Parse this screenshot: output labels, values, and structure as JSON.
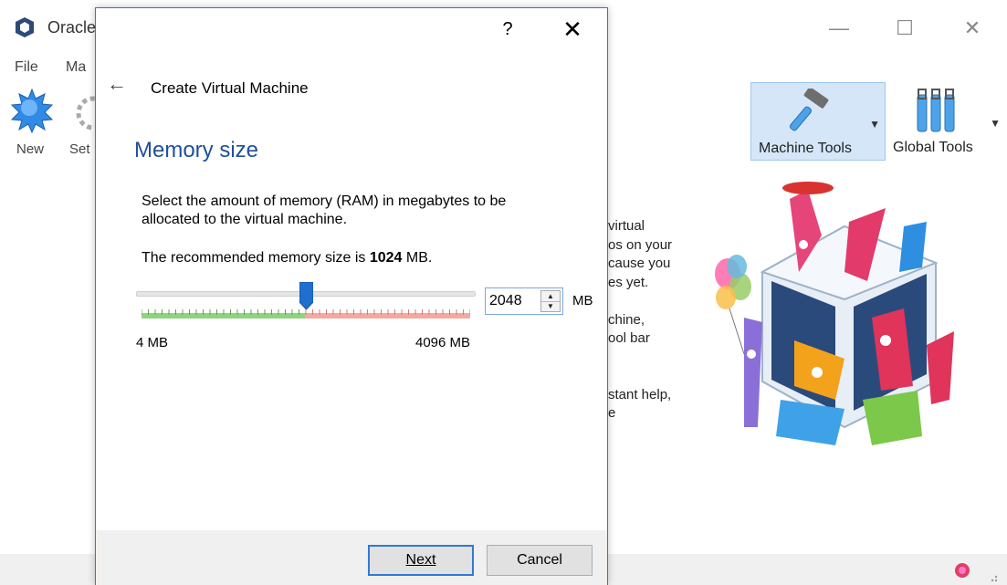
{
  "main_window": {
    "title": "Oracle",
    "controls": {
      "minimize": "—",
      "maximize": "☐",
      "close": "✕"
    },
    "menu": [
      "File",
      "Ma"
    ],
    "toolbar": {
      "new_label": "New",
      "settings_label": "Set"
    },
    "tools": {
      "machine_tools": "Machine Tools",
      "global_tools": "Global Tools",
      "dropdown": "▼"
    },
    "welcome_lines": [
      "virtual",
      "os on your",
      "cause you",
      "es yet.",
      "",
      "chine,",
      "ool bar",
      "",
      "",
      "stant help,",
      "e"
    ]
  },
  "dialog": {
    "help": "?",
    "close": "✕",
    "back_icon": "←",
    "heading": "Create Virtual Machine",
    "page_title": "Memory size",
    "description": "Select the amount of memory (RAM) in megabytes to be allocated to the virtual machine.",
    "recommendation_prefix": "The recommended memory size is ",
    "recommendation_value": "1024",
    "recommendation_suffix": " MB.",
    "slider": {
      "min": 4,
      "max": 4096,
      "value": 2048,
      "recommended": 1024
    },
    "min_label": "4 MB",
    "max_label": "4096 MB",
    "memory_input": "2048",
    "unit": "MB",
    "buttons": {
      "next": "Next",
      "cancel": "Cancel"
    }
  },
  "colors": {
    "accent": "#2b79d6",
    "title_blue": "#1f4f9e",
    "safe": "#8fd27f",
    "warn": "#f3a9a0",
    "handle": "#1e6fd0"
  }
}
